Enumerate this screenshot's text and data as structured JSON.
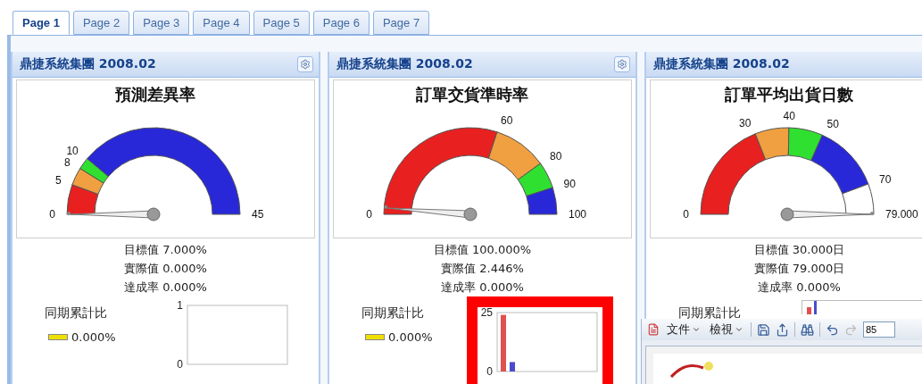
{
  "tabs": [
    {
      "label": "Page 1",
      "selected": true
    },
    {
      "label": "Page 2",
      "selected": false
    },
    {
      "label": "Page 3",
      "selected": false
    },
    {
      "label": "Page 4",
      "selected": false
    },
    {
      "label": "Page 5",
      "selected": false
    },
    {
      "label": "Page 6",
      "selected": false
    },
    {
      "label": "Page 7",
      "selected": false
    }
  ],
  "panels": [
    {
      "header": "鼎捷系統集團 2008.02",
      "settings_button": true,
      "gauge": {
        "title": "預測差異率",
        "labels": [
          "0",
          "5",
          "8",
          "10",
          "45"
        ],
        "bands": [
          {
            "color": "#e82020"
          },
          {
            "color": "#f0a040"
          },
          {
            "color": "#30e030"
          },
          {
            "color": "#2828d8"
          }
        ],
        "needle": {
          "level": 0
        }
      },
      "stats": [
        "目標值 7.000%",
        "實際值 0.000%",
        "達成率 0.000%"
      ],
      "trend": {
        "label": "同期累計比",
        "legend": {
          "text": "0.000%",
          "color": "#f0e000"
        },
        "highlighted": false,
        "axis_labels": [
          "1",
          "0"
        ]
      }
    },
    {
      "header": "鼎捷系統集團 2008.02",
      "settings_button": true,
      "gauge": {
        "title": "訂單交貨準時率",
        "labels": [
          "0",
          "60",
          "80",
          "90",
          "100"
        ],
        "bands": [
          {
            "color": "#e82020"
          },
          {
            "color": "#f0a040"
          },
          {
            "color": "#30e030"
          },
          {
            "color": "#2828d8"
          }
        ],
        "needle": {
          "level": 0.024
        }
      },
      "stats": [
        "目標值 100.000%",
        "實際值 2.446%",
        "達成率 0.000%"
      ],
      "trend": {
        "label": "同期累計比",
        "legend": {
          "text": "0.000%",
          "color": "#f0e000"
        },
        "highlighted": true,
        "chart_data": {
          "type": "bar",
          "categories": [
            null
          ],
          "ylim": [
            0,
            25
          ],
          "yticks": [
            0,
            25
          ],
          "series": [
            {
              "color": "#e05050",
              "values": [
                24
              ]
            },
            {
              "color": "#4a4ad0",
              "values": [
                4
              ]
            }
          ]
        }
      }
    },
    {
      "header": "鼎捷系統集團 2008.02",
      "settings_button": false,
      "gauge": {
        "title": "訂單平均出貨日數",
        "labels": [
          "0",
          "30",
          "40",
          "50",
          "70",
          "79.000"
        ],
        "bands": [
          {
            "color": "#e82020"
          },
          {
            "color": "#f0a040"
          },
          {
            "color": "#30e030"
          },
          {
            "color": "#2828d8"
          },
          {
            "color": "#ffffff"
          }
        ],
        "needle": {
          "level": 1
        }
      },
      "stats": [
        "目標值 30.000日",
        "實際值 79.000日",
        "達成率 0.000%"
      ],
      "trend": {
        "label": "同期累計比",
        "highlighted": false
      }
    }
  ],
  "report_window": {
    "toolbar": [
      {
        "kind": "menu",
        "label": "文件"
      },
      {
        "kind": "menu",
        "label": "檢視"
      },
      {
        "kind": "separator"
      },
      {
        "kind": "save"
      },
      {
        "kind": "export"
      },
      {
        "kind": "separator"
      },
      {
        "kind": "find"
      },
      {
        "kind": "separator"
      },
      {
        "kind": "undo",
        "disabled": false
      },
      {
        "kind": "redo",
        "disabled": true
      },
      {
        "kind": "field",
        "value": "85"
      }
    ]
  }
}
